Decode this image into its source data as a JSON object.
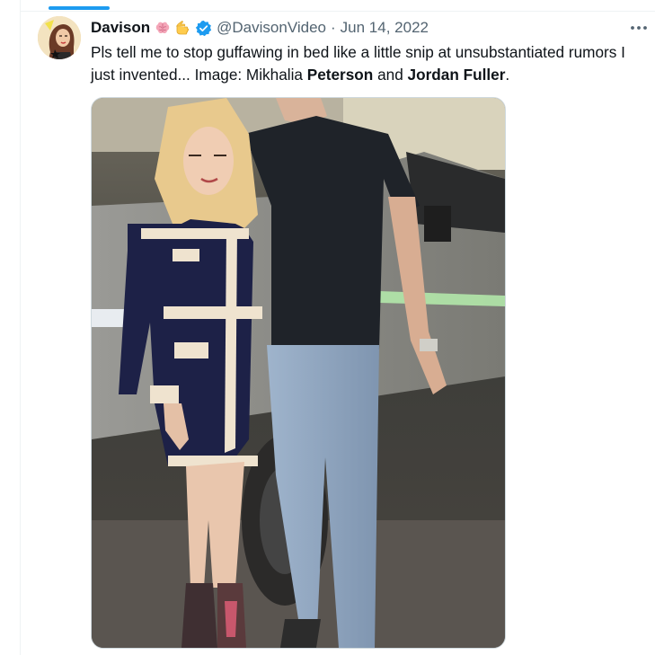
{
  "tweet": {
    "display_name": "Davison",
    "name_emojis": [
      "brain-icon",
      "pointing-hand-icon"
    ],
    "verified": true,
    "handle": "@DavisonVideo",
    "separator": "·",
    "date": "Jun 14, 2022",
    "text": {
      "intro": "Pls tell me to stop guffawing in bed like a little snip at unsubstantiated rumors I just invented... Image: Mikhalia ",
      "name1": "Peterson",
      "and": " and ",
      "name2": "Jordan Fuller",
      "end": "."
    },
    "more_label": "More"
  },
  "colors": {
    "accent": "#1d9bf0",
    "text": "#0f1419",
    "secondary": "#536471",
    "border": "#eff3f4"
  }
}
